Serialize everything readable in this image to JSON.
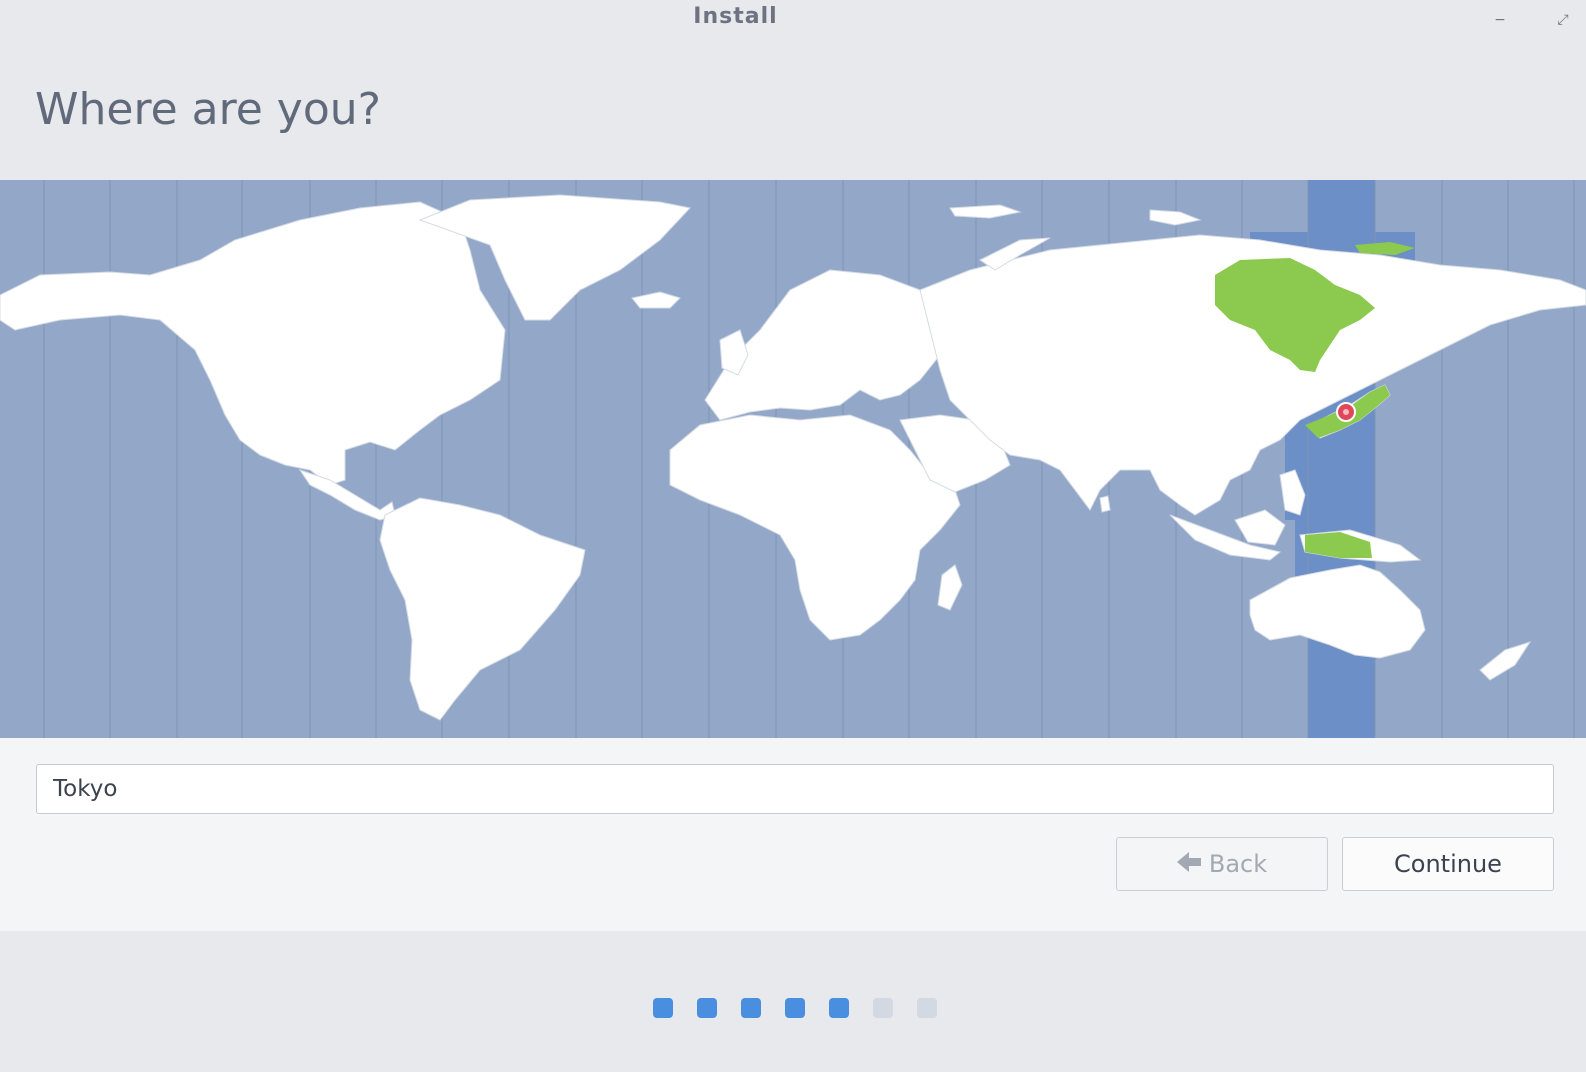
{
  "window": {
    "title": "Install",
    "minimize_glyph": "−",
    "maximize_glyph": "⤢"
  },
  "page": {
    "heading": "Where are you?"
  },
  "map": {
    "selected_city": "Tokyo",
    "colors": {
      "ocean": "#93a8c9",
      "land": "#ffffff",
      "selected_zone": "#6b8fc6",
      "highlight_region": "#8cc94f",
      "pin": "#e0485a"
    }
  },
  "timezone": {
    "value": "Tokyo"
  },
  "buttons": {
    "back_label": "Back",
    "back_icon": "arrow-left-icon",
    "continue_label": "Continue"
  },
  "progress": {
    "total_steps": 7,
    "completed_steps": 5
  }
}
